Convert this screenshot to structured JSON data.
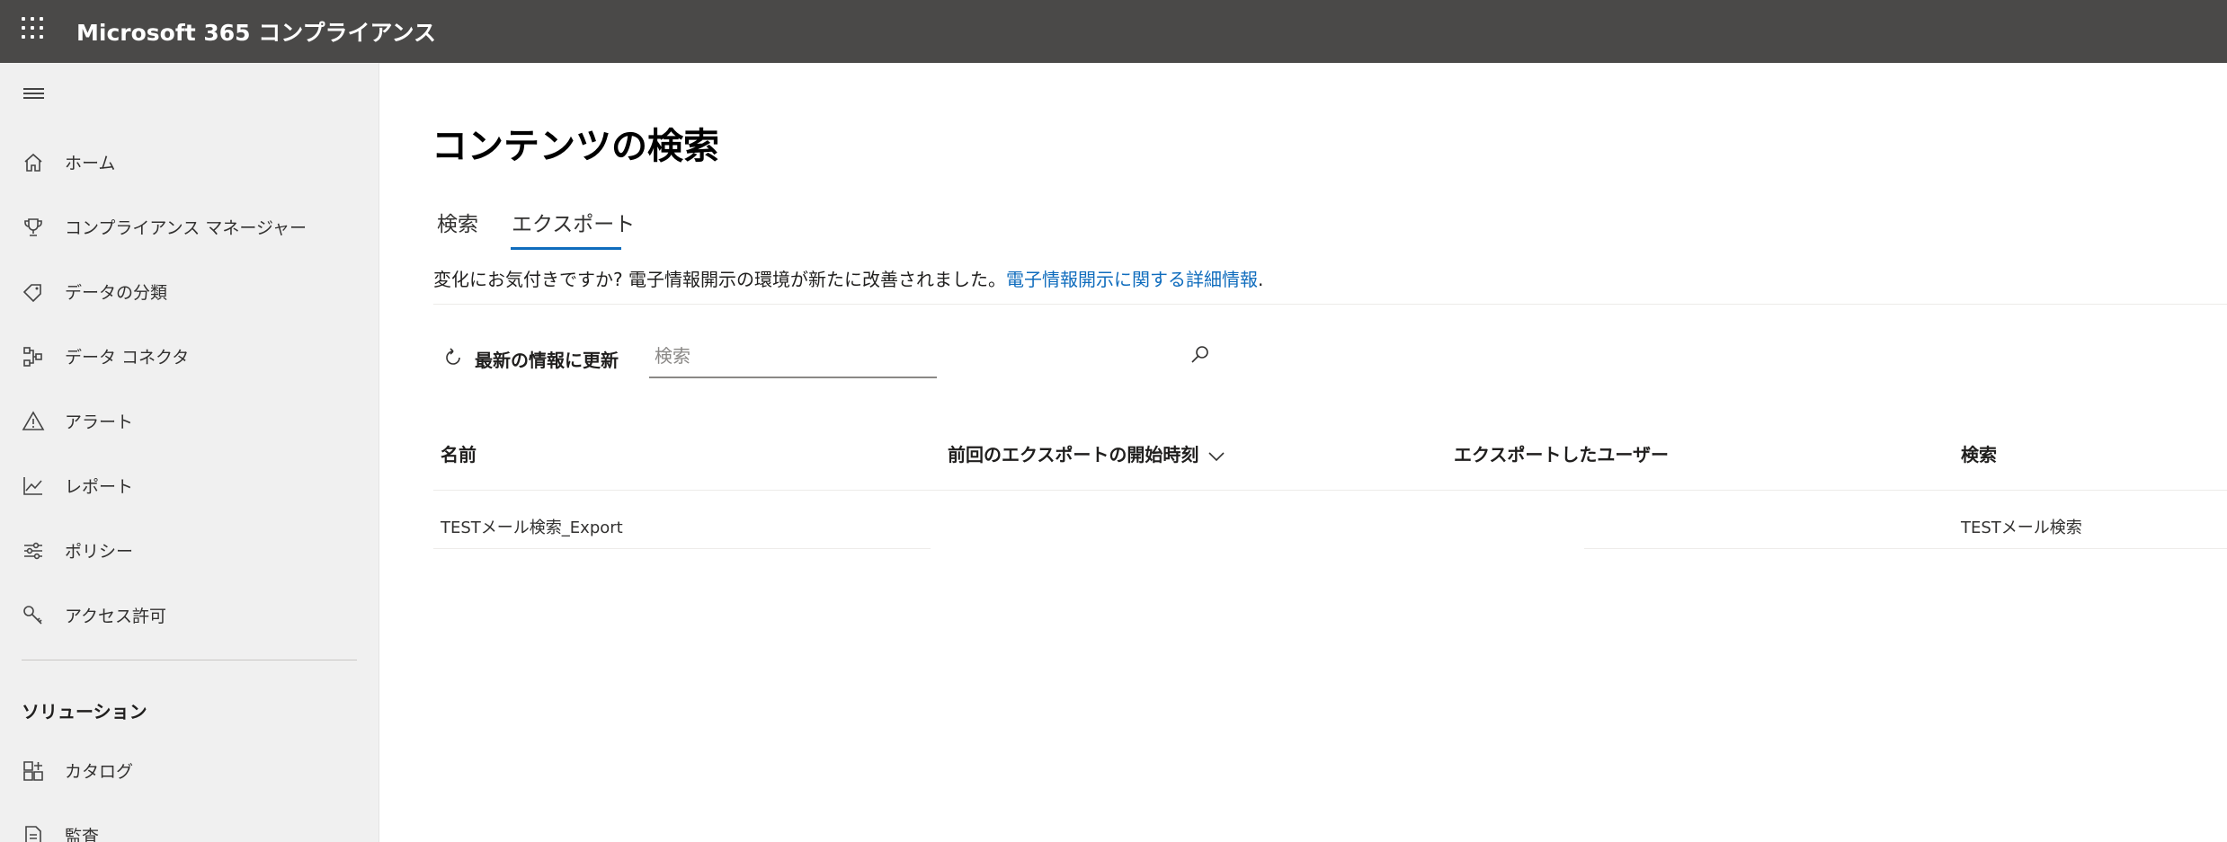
{
  "app": {
    "title": "Microsoft 365 コンプライアンス"
  },
  "sidebar": {
    "items": [
      {
        "label": "ホーム",
        "icon": "home-icon"
      },
      {
        "label": "コンプライアンス マネージャー",
        "icon": "trophy-icon"
      },
      {
        "label": "データの分類",
        "icon": "tag-icon"
      },
      {
        "label": "データ コネクタ",
        "icon": "connector-icon"
      },
      {
        "label": "アラート",
        "icon": "warning-icon"
      },
      {
        "label": "レポート",
        "icon": "chart-line-icon"
      },
      {
        "label": "ポリシー",
        "icon": "sliders-icon"
      },
      {
        "label": "アクセス許可",
        "icon": "key-icon"
      }
    ],
    "section_title": "ソリューション",
    "solution_items": [
      {
        "label": "カタログ",
        "icon": "catalog-icon"
      },
      {
        "label": "監査",
        "icon": "audit-icon"
      }
    ]
  },
  "main": {
    "page_title": "コンテンツの検索",
    "tabs": [
      {
        "label": "検索",
        "active": false
      },
      {
        "label": "エクスポート",
        "active": true
      }
    ],
    "notice_text": "変化にお気付きですか? 電子情報開示の環境が新たに改善されました。",
    "notice_link": "電子情報開示に関する詳細情報",
    "notice_end": ".",
    "refresh_label": "最新の情報に更新",
    "search_placeholder": "検索",
    "table": {
      "columns": [
        "名前",
        "前回のエクスポートの開始時刻",
        "エクスポートしたユーザー",
        "検索"
      ],
      "rows": [
        {
          "name": "TESTメール検索_Export",
          "last_export_start": "",
          "exported_by": "",
          "search": "TESTメール検索"
        }
      ]
    }
  },
  "colors": {
    "topbar": "#4a4948",
    "sidebar_bg": "#f0f0f0",
    "accent": "#0f6cbd"
  }
}
